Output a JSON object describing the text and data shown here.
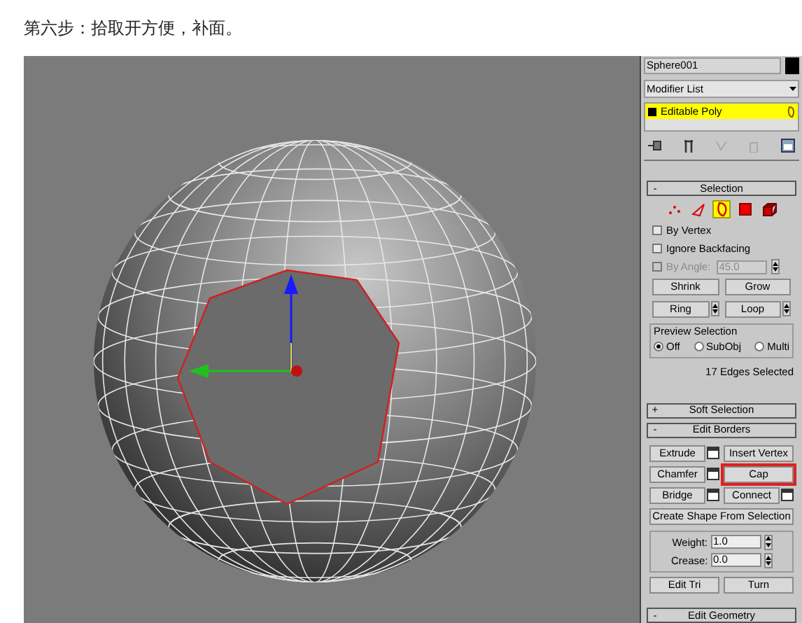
{
  "caption": "第六步：拾取开方便，补面。",
  "command_panel": {
    "object_name": "Sphere001",
    "modifier_list": "Modifier List",
    "modifier_stack": [
      {
        "label": "Editable Poly",
        "selected": true
      }
    ],
    "selection": {
      "sign": "-",
      "title": "Selection",
      "subobject_modes": [
        {
          "kind": "vertex",
          "selected": false
        },
        {
          "kind": "edge",
          "selected": false
        },
        {
          "kind": "border",
          "selected": true
        },
        {
          "kind": "polygon",
          "selected": false
        },
        {
          "kind": "element",
          "selected": false
        }
      ],
      "checks": [
        {
          "label": "By Vertex",
          "checked": false,
          "disabled": false
        },
        {
          "label": "Ignore Backfacing",
          "checked": false,
          "disabled": false
        },
        {
          "label": "By Angle:",
          "checked": false,
          "disabled": true
        }
      ],
      "angle_value": "45.0",
      "buttons": [
        {
          "label": "Shrink",
          "spinner": false
        },
        {
          "label": "Grow",
          "spinner": false
        },
        {
          "label": "Ring",
          "spinner": true
        },
        {
          "label": "Loop",
          "spinner": true
        }
      ],
      "preview": {
        "title": "Preview Selection",
        "options": [
          {
            "label": "Off",
            "selected": true
          },
          {
            "label": "SubObj",
            "selected": false
          },
          {
            "label": "Multi",
            "selected": false
          }
        ]
      },
      "status": "17 Edges Selected"
    },
    "rollouts": [
      {
        "sign": "+",
        "title": "Soft Selection"
      },
      {
        "sign": "-",
        "title": "Edit Borders"
      }
    ],
    "edit_borders": {
      "buttons": [
        {
          "label": "Extrude",
          "settings": true,
          "highlighted": false
        },
        {
          "label": "Insert Vertex",
          "settings": false,
          "highlighted": false
        },
        {
          "label": "Chamfer",
          "settings": true,
          "highlighted": false
        },
        {
          "label": "Cap",
          "settings": false,
          "highlighted": true
        },
        {
          "label": "Bridge",
          "settings": true,
          "highlighted": false
        },
        {
          "label": "Connect",
          "settings": true,
          "highlighted": false
        }
      ],
      "create_shape": "Create Shape From Selection",
      "fields": [
        {
          "label": "Weight:",
          "value": "1.0"
        },
        {
          "label": "Crease:",
          "value": "0.0"
        }
      ],
      "bottom_buttons": [
        "Edit Tri",
        "Turn"
      ]
    },
    "next_rollout": {
      "sign": "-",
      "title": "Edit Geometry"
    }
  }
}
